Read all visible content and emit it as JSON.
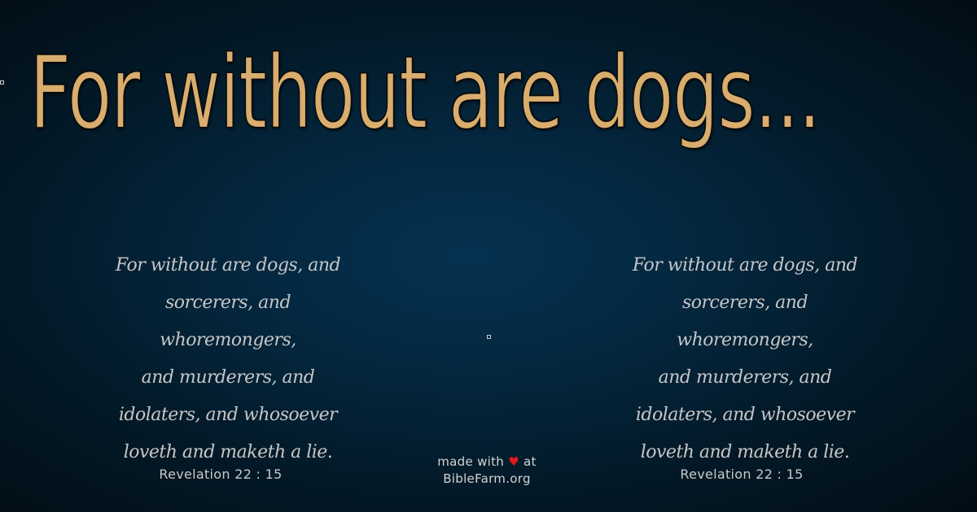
{
  "headline": "For without are dogs...",
  "verse_left": {
    "lines": [
      "For without are dogs, and",
      "sorcerers, and whoremongers,",
      "and murderers, and",
      "idolaters, and whosoever",
      "loveth and maketh a lie."
    ]
  },
  "verse_right": {
    "lines": [
      "For without are dogs, and",
      "sorcerers, and whoremongers,",
      "and murderers, and",
      "idolaters, and whosoever",
      "loveth and maketh a lie."
    ]
  },
  "reference_left": "Revelation 22 : 15",
  "reference_right": "Revelation 22 : 15",
  "credit": {
    "prefix": "made with",
    "heart": "♥",
    "suffix": "at",
    "site": "BibleFarm.org"
  },
  "colors": {
    "headline": "#d8ad6e",
    "verse_text": "#c6c6c6",
    "heart": "#e01818",
    "background": "#042840"
  }
}
